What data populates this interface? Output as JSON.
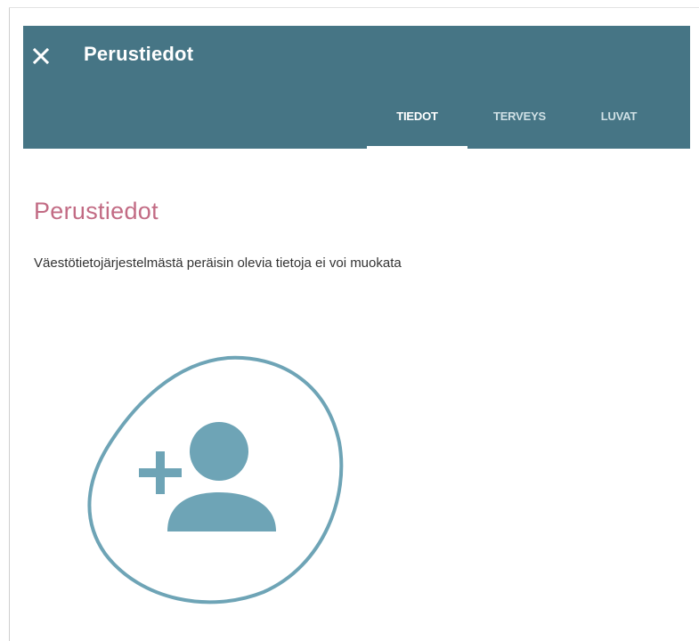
{
  "header": {
    "title": "Perustiedot",
    "close_icon": "close-icon",
    "background_color": "#467585"
  },
  "tabs": [
    {
      "label": "TIEDOT",
      "active": true
    },
    {
      "label": "TERVEYS",
      "active": false
    },
    {
      "label": "LUVAT",
      "active": false
    }
  ],
  "main": {
    "heading": "Perustiedot",
    "heading_color": "#c26b84",
    "info_text": "Väestötietojärjestelmästä peräisin olevia tietoja ei voi muokata",
    "avatar_icon": "add-person-icon",
    "icon_color": "#6ea4b6"
  }
}
